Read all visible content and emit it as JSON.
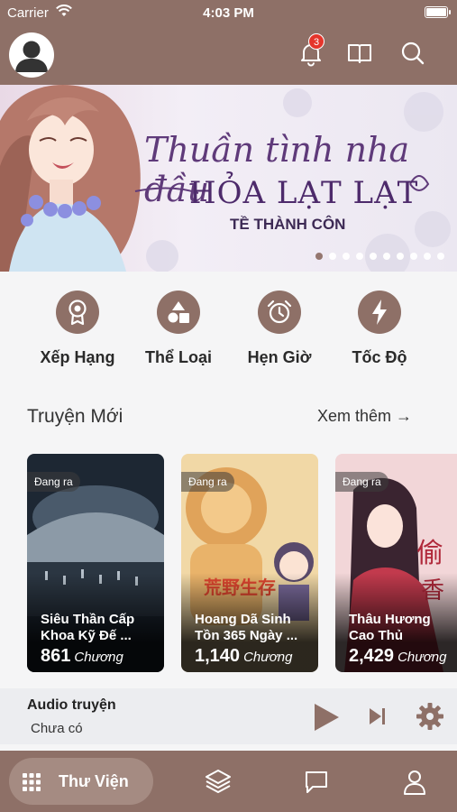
{
  "status": {
    "carrier": "Carrier",
    "time": "4:03 PM"
  },
  "header": {
    "notification_count": "3"
  },
  "banner": {
    "title_line1": "Thuần tình nha đầu",
    "title_line2": "HỎA LẠT LẠT",
    "author": "TỀ THÀNH CÔN",
    "slide_count": 10,
    "active_slide": 0
  },
  "categories": [
    {
      "label": "Xếp Hạng",
      "icon": "award-icon"
    },
    {
      "label": "Thể Loại",
      "icon": "shapes-icon"
    },
    {
      "label": "Hẹn Giờ",
      "icon": "alarm-icon"
    },
    {
      "label": "Tốc Độ",
      "icon": "lightning-icon"
    }
  ],
  "section": {
    "title": "Truyện Mới",
    "more": "Xem thêm →"
  },
  "cards": [
    {
      "tag": "Đang ra",
      "title": "Siêu Thần Cấp Khoa Kỹ Đế ...",
      "count": "861",
      "unit": "Chương",
      "color": "#1c2530"
    },
    {
      "tag": "Đang ra",
      "title": "Hoang Dã Sinh Tồn 365 Ngày ...",
      "count": "1,140",
      "unit": "Chương",
      "color": "#d9a24a"
    },
    {
      "tag": "Đang ra",
      "title": "Thâu Hương Cao Thủ",
      "count": "2,429",
      "unit": "Chương",
      "color": "#c84a5c"
    }
  ],
  "audio": {
    "title": "Audio truyện",
    "status": "Chưa có"
  },
  "bottom_nav": {
    "library_label": "Thư Viện"
  },
  "colors": {
    "brand": "#8e7067",
    "badge": "#e5352b"
  }
}
